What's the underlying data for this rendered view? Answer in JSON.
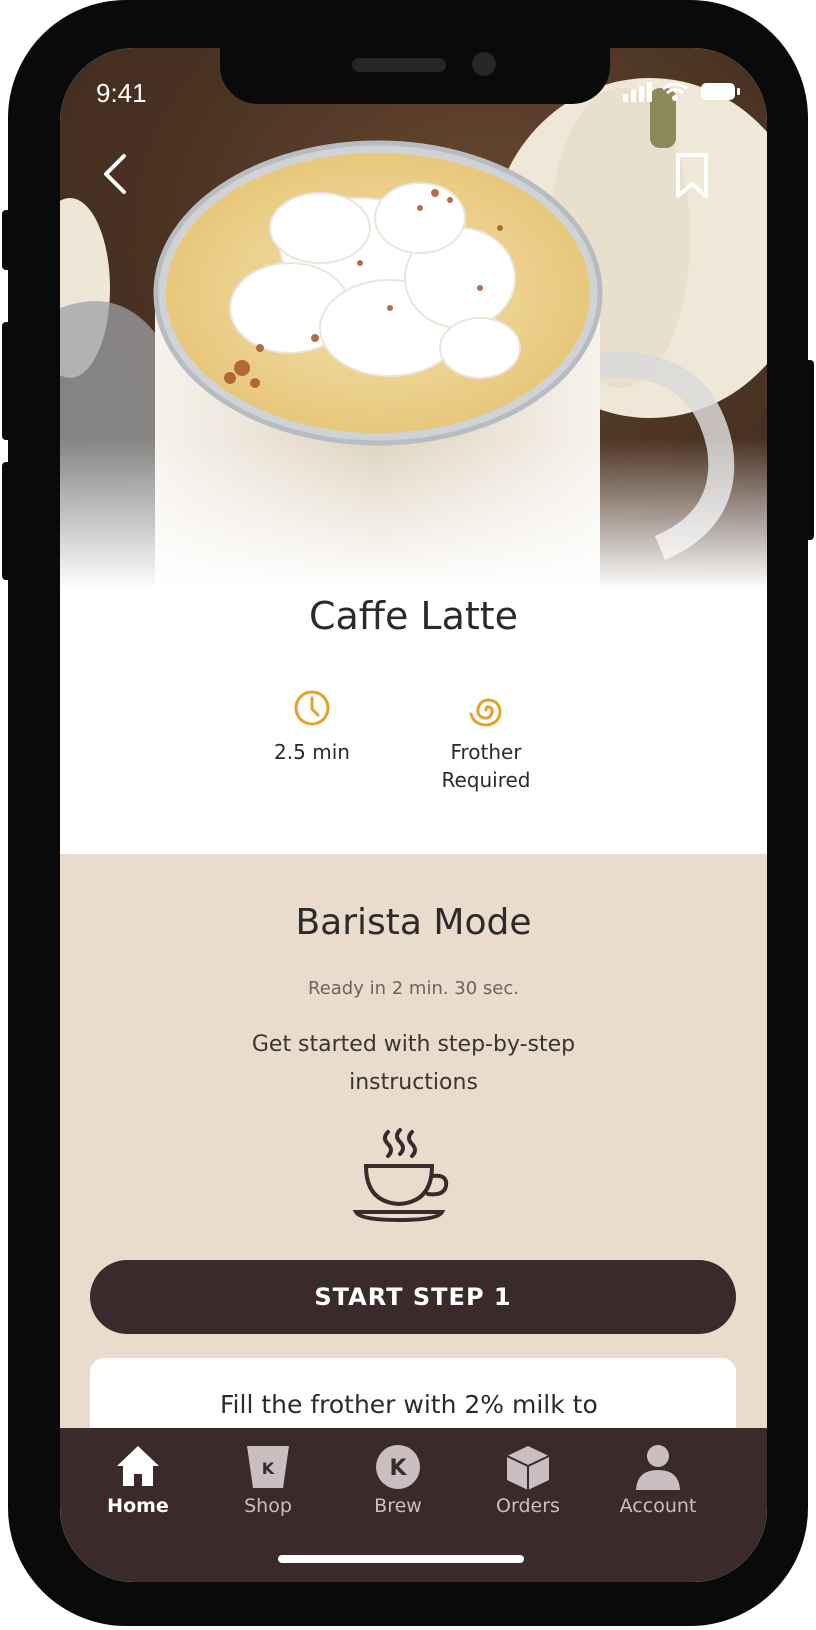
{
  "status_bar": {
    "time": "9:41"
  },
  "recipe": {
    "title": "Caffe Latte",
    "time": "2.5 min",
    "equipment_line1": "Frother",
    "equipment_line2": "Required"
  },
  "barista_mode": {
    "title": "Barista Mode",
    "ready_text": "Ready in 2 min. 30 sec.",
    "description_line1": "Get started with step-by-step",
    "description_line2": "instructions",
    "start_button": "START STEP 1",
    "step_preview": "Fill the frother with 2% milk to"
  },
  "tab_bar": {
    "items": [
      {
        "label": "Home",
        "icon": "home-icon",
        "active": true
      },
      {
        "label": "Shop",
        "icon": "cup-pod-icon",
        "active": false
      },
      {
        "label": "Brew",
        "icon": "brew-k-icon",
        "active": false
      },
      {
        "label": "Orders",
        "icon": "box-icon",
        "active": false
      },
      {
        "label": "Account",
        "icon": "person-icon",
        "active": false
      }
    ]
  },
  "colors": {
    "accent": "#e3a32d",
    "barista_bg": "#e9dccd",
    "dark": "#3b2a2c"
  }
}
